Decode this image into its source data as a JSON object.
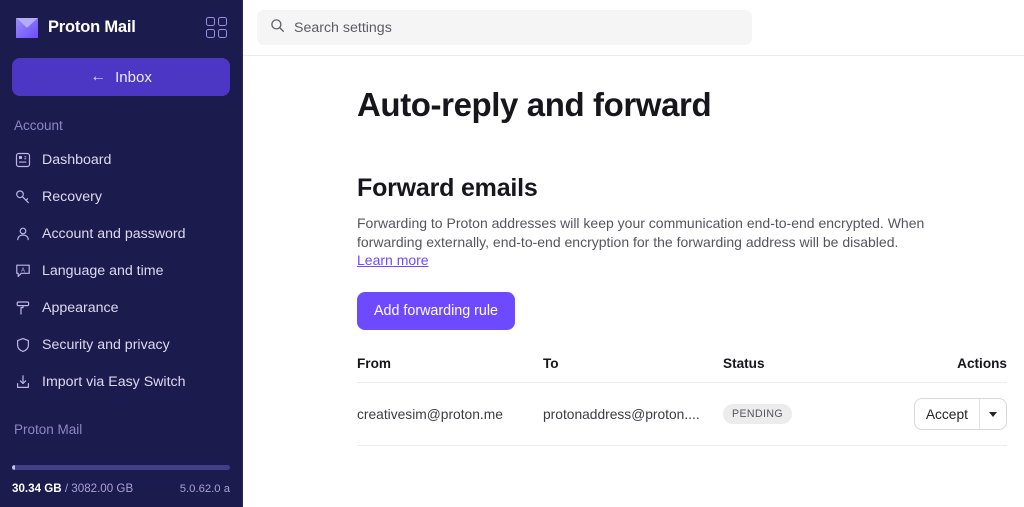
{
  "sidebar": {
    "brand": "Proton Mail",
    "apps_icon": "apps-grid-icon",
    "logo_icon": "proton-mail-logo-icon",
    "inbox_button": {
      "label": "Inbox",
      "icon": "arrow-left-icon"
    },
    "section_label": "Account",
    "items": [
      {
        "label": "Dashboard",
        "icon": "dashboard-icon"
      },
      {
        "label": "Recovery",
        "icon": "key-icon"
      },
      {
        "label": "Account and password",
        "icon": "user-icon"
      },
      {
        "label": "Language and time",
        "icon": "language-icon"
      },
      {
        "label": "Appearance",
        "icon": "paint-roller-icon"
      },
      {
        "label": "Security and privacy",
        "icon": "shield-icon"
      },
      {
        "label": "Import via Easy Switch",
        "icon": "import-icon"
      }
    ],
    "app_section_label": "Proton Mail",
    "storage": {
      "used": "30.34 GB",
      "separator": " / ",
      "total": "3082.00 GB",
      "percent": 1
    },
    "version": "5.0.62.0 a"
  },
  "topbar": {
    "search": {
      "placeholder": "Search settings",
      "value": "",
      "icon": "search-icon"
    }
  },
  "main": {
    "page_title": "Auto-reply and forward",
    "section": {
      "title": "Forward emails",
      "description": "Forwarding to Proton addresses will keep your communication end-to-end encrypted. When forwarding externally, end-to-end encryption for the forwarding address will be disabled.",
      "learn_more": "Learn more",
      "add_button": "Add forwarding rule"
    },
    "table": {
      "headers": {
        "from": "From",
        "to": "To",
        "status": "Status",
        "actions": "Actions"
      },
      "rows": [
        {
          "from": "creativesim@proton.me",
          "to": "protonaddress@proton....",
          "status": "PENDING",
          "action_label": "Accept",
          "action_caret_icon": "chevron-down-icon"
        }
      ]
    }
  },
  "annotation": {
    "highlight_color": "#FF0000",
    "target": "accept-button"
  },
  "colors": {
    "sidebar_bg": "#1C1B4D",
    "accent": "#6D4AFF",
    "inbox_btn": "#4B37C4",
    "badge_bg": "#ececed"
  }
}
